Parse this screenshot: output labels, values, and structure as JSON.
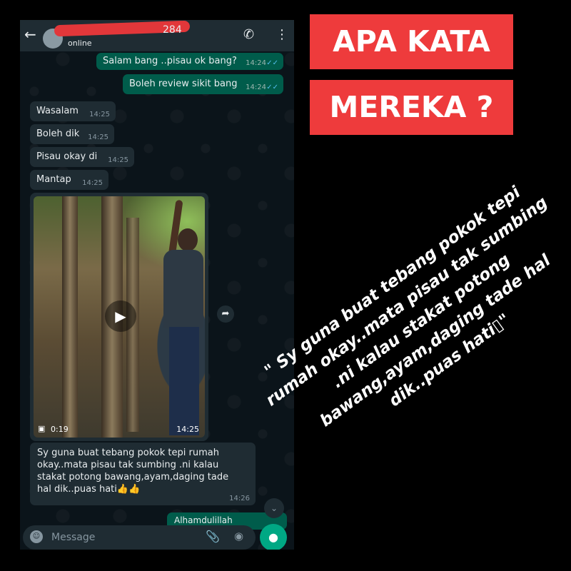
{
  "chat": {
    "header": {
      "name_suffix": "284",
      "status": "online"
    },
    "messages_out": [
      {
        "text": "Salam bang ..pisau ok bang?",
        "time": "14:24"
      },
      {
        "text": "Boleh review sikit bang",
        "time": "14:24"
      }
    ],
    "messages_in": [
      {
        "text": "Wasalam",
        "time": "14:25"
      },
      {
        "text": "Boleh dik",
        "time": "14:25"
      },
      {
        "text": "Pisau okay di",
        "time": "14:25"
      },
      {
        "text": "Mantap",
        "time": "14:25"
      }
    ],
    "video": {
      "duration": "0:19",
      "time": "14:25"
    },
    "long_message": {
      "text": "Sy guna buat tebang pokok tepi rumah okay..mata pisau tak sumbing .ni kalau stakat potong bawang,ayam,daging tade hal dik..puas hati👍👍",
      "time": "14:26"
    },
    "partial_out": {
      "text": "Alhamdulillah"
    },
    "input": {
      "placeholder": "Message"
    },
    "icons": [
      "back-arrow-icon",
      "avatar",
      "add-call-icon",
      "menu-icon",
      "play-icon",
      "video-camera-icon",
      "forward-icon",
      "scroll-down-icon",
      "emoji-icon",
      "attach-icon",
      "camera-icon",
      "mic-icon"
    ],
    "colors": {
      "outgoing": "#005c4b",
      "incoming": "#1f2c33",
      "accent": "#00a884",
      "redaction": "#e2373a"
    }
  },
  "heading": {
    "line1": "APA KATA",
    "line2": "MEREKA ?"
  },
  "heading_color": "#ee3b3c",
  "quote": "\" Sy guna buat tebang pokok tepi rumah okay..mata pisau tak sumbing .ni kalau stakat potong bawang,ayam,daging tade hal dik..puas hati▯\""
}
